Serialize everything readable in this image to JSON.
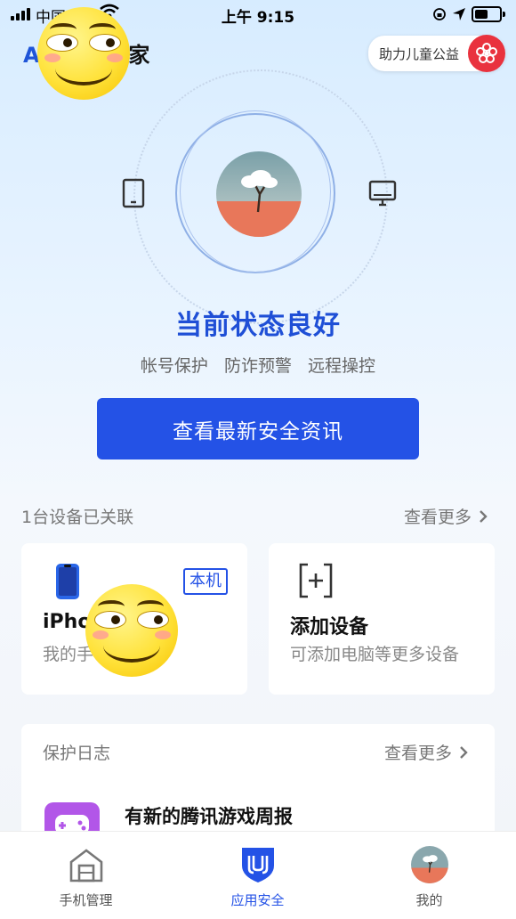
{
  "status_bar": {
    "carrier": "中国电信",
    "time": "上午 9:15"
  },
  "header": {
    "title_prefix": "A...",
    "title_suffix": "的管家",
    "charity_label": "助力儿童公益"
  },
  "hero": {
    "state_text": "当前状态良好",
    "features": [
      "帐号保护",
      "防诈预警",
      "远程操控"
    ],
    "main_button": "查看最新安全资讯"
  },
  "devices": {
    "section_label": "1台设备已关联",
    "more_label": "查看更多",
    "current_device": {
      "name": "iPho",
      "subtitle": "我的手",
      "badge": "本机"
    },
    "add_device": {
      "title": "添加设备",
      "subtitle": "可添加电脑等更多设备"
    }
  },
  "log": {
    "title": "保护日志",
    "more_label": "查看更多",
    "items": [
      {
        "text": "有新的腾讯游戏周报",
        "icon": "game-controller-icon"
      }
    ]
  },
  "tabbar": {
    "items": [
      {
        "label": "手机管理",
        "icon": "house-icon",
        "active": false
      },
      {
        "label": "应用安全",
        "icon": "shield-icon",
        "active": true
      },
      {
        "label": "我的",
        "icon": "avatar-icon",
        "active": false
      }
    ]
  },
  "colors": {
    "accent": "#2452e6",
    "charity_red": "#e9323e"
  }
}
